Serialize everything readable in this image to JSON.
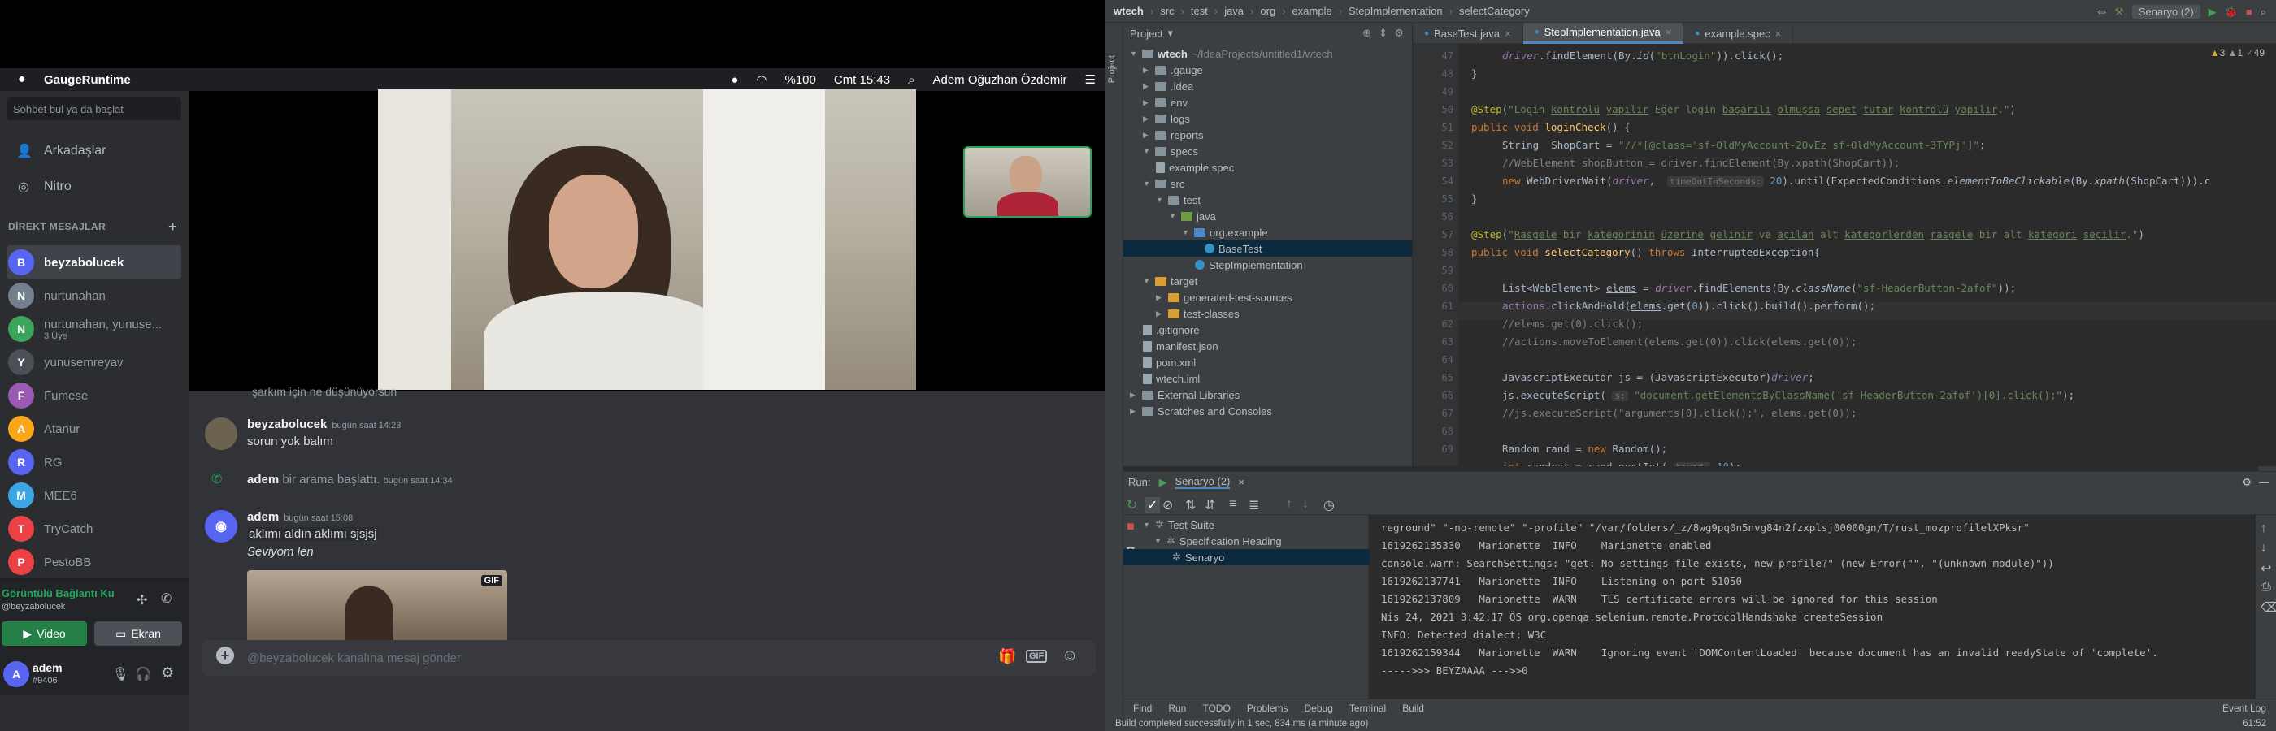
{
  "discord": {
    "menubar": {
      "app_name": "GaugeRuntime",
      "battery": "%100",
      "clock": "Cmt 15:43",
      "user": "Adem Oğuzhan Özdemir"
    },
    "search_placeholder": "Sohbet bul ya da başlat",
    "nav": [
      {
        "label": "Arkadaşlar"
      },
      {
        "label": "Nitro"
      }
    ],
    "dm_header": "DİREKT MESAJLAR",
    "dms": [
      {
        "name": "beyzabolucek",
        "active": true,
        "color": "#5865f2"
      },
      {
        "name": "nurtunahan",
        "color": "#747f8d"
      },
      {
        "name": "nurtunahan, yunuse...",
        "sub": "3 Üye",
        "color": "#3ba55c"
      },
      {
        "name": "yunusemreyav",
        "color": "#4e5058"
      },
      {
        "name": "Fumese",
        "color": "#9b59b6"
      },
      {
        "name": "Atanur",
        "color": "#faa61a"
      },
      {
        "name": "RG",
        "color": "#5865f2"
      },
      {
        "name": "MEE6",
        "color": "#3ba5e6"
      },
      {
        "name": "TryCatch",
        "color": "#ed4245"
      },
      {
        "name": "PestoBB",
        "color": "#ed4245"
      }
    ],
    "voice": {
      "title": "Görüntülü Bağlantı Ku",
      "sub": "@beyzabolucek",
      "video_btn": "Video",
      "screen_btn": "Ekran"
    },
    "user": {
      "name": "adem",
      "tag": "#9406"
    },
    "partial_top_msg": "şarkım için ne düşünüyorsun",
    "messages": [
      {
        "author": "beyzabolucek",
        "time": "bugün saat 14:23",
        "text": "sorun yok balım"
      },
      {
        "author": "adem",
        "time": "bugün saat 14:34",
        "text": "bir arama başlattı."
      },
      {
        "author": "adem",
        "time": "bugün saat 15:08",
        "text": "aklımı aldın aklımı sjsjsj",
        "text2": "Seviyom len",
        "gif": "GIF"
      }
    ],
    "input_placeholder": "@beyzabolucek kanalına mesaj gönder"
  },
  "ide": {
    "breadcrumbs": [
      "wtech",
      "src",
      "test",
      "java",
      "org",
      "example",
      "StepImplementation",
      "selectCategory"
    ],
    "run_config": "Senaryo (2)",
    "project_label": "Project",
    "project_root": "wtech",
    "project_path": "~/IdeaProjects/untitled1/wtech",
    "tree": [
      {
        "label": ".gauge",
        "depth": 1
      },
      {
        "label": ".idea",
        "depth": 1
      },
      {
        "label": "env",
        "depth": 1
      },
      {
        "label": "logs",
        "depth": 1
      },
      {
        "label": "reports",
        "depth": 1
      },
      {
        "label": "specs",
        "depth": 1
      },
      {
        "label": "example.spec",
        "depth": 2
      },
      {
        "label": "src",
        "depth": 1
      },
      {
        "label": "test",
        "depth": 2
      },
      {
        "label": "java",
        "depth": 3
      },
      {
        "label": "org.example",
        "depth": 4
      },
      {
        "label": "BaseTest",
        "depth": 5
      },
      {
        "label": "StepImplementation",
        "depth": 5
      },
      {
        "label": "target",
        "depth": 1
      },
      {
        "label": "generated-test-sources",
        "depth": 2
      },
      {
        "label": "test-classes",
        "depth": 2
      },
      {
        "label": ".gitignore",
        "depth": 1
      },
      {
        "label": "manifest.json",
        "depth": 1
      },
      {
        "label": "pom.xml",
        "depth": 1
      },
      {
        "label": "wtech.iml",
        "depth": 1
      },
      {
        "label": "External Libraries",
        "depth": 0
      },
      {
        "label": "Scratches and Consoles",
        "depth": 0
      }
    ],
    "tabs": [
      {
        "label": "BaseTest.java"
      },
      {
        "label": "StepImplementation.java",
        "active": true
      },
      {
        "label": "example.spec"
      }
    ],
    "inspections": {
      "warnings": "3",
      "weak": "1",
      "typos": "49"
    },
    "line_numbers": [
      "47",
      "48",
      "49",
      "50",
      "51",
      "52",
      "53",
      "54",
      "55",
      "56",
      "57",
      "58",
      "59",
      "60",
      "61",
      "62",
      "63",
      "64",
      "65",
      "66",
      "67",
      "68",
      "69"
    ],
    "run": {
      "label": "Run:",
      "config": "Senaryo (2)",
      "tree": [
        "Test Suite",
        "Specification Heading",
        "Senaryo"
      ],
      "console": [
        "reground\" \"-no-remote\" \"-profile\" \"/var/folders/_z/8wg9pq0n5nvg84n2fzxplsj00000gn/T/rust_mozprofilelXPksr\"",
        "1619262135330   Marionette  INFO    Marionette enabled",
        "console.warn: SearchSettings: \"get: No settings file exists, new profile?\" (new Error(\"\", \"(unknown module)\"))",
        "1619262137741   Marionette  INFO    Listening on port 51050",
        "1619262137809   Marionette  WARN    TLS certificate errors will be ignored for this session",
        "Nis 24, 2021 3:42:17 ÖS org.openqa.selenium.remote.ProtocolHandshake createSession",
        "INFO: Detected dialect: W3C",
        "1619262159344   Marionette  WARN    Ignoring event 'DOMContentLoaded' because document has an invalid readyState of 'complete'.",
        "----->>> BEYZAAAA --->>0"
      ]
    },
    "bottom_tools": [
      "Find",
      "Run",
      "TODO",
      "Problems",
      "Debug",
      "Terminal",
      "Build",
      "Event Log"
    ],
    "status": "Build completed successfully in 1 sec, 834 ms (a minute ago)",
    "cursor_pos": "61:52"
  }
}
